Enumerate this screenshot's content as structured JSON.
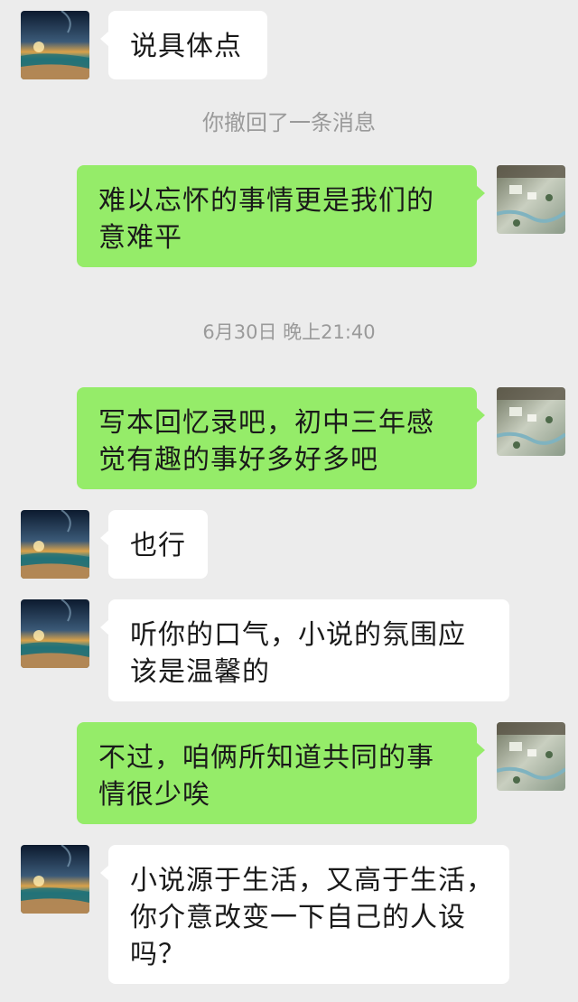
{
  "messages": [
    {
      "kind": "text",
      "side": "left",
      "lines": [
        "说具体点"
      ]
    },
    {
      "kind": "system",
      "text": "你撤回了一条消息"
    },
    {
      "kind": "text",
      "side": "right",
      "lines": [
        "难以忘怀的事情更是我们的",
        "意难平"
      ]
    },
    {
      "kind": "timestamp",
      "text": "6月30日 晚上21:40"
    },
    {
      "kind": "text",
      "side": "right",
      "lines": [
        "写本回忆录吧，初中三年感",
        "觉有趣的事好多好多吧"
      ]
    },
    {
      "kind": "text",
      "side": "left",
      "lines": [
        "也行"
      ]
    },
    {
      "kind": "text",
      "side": "left",
      "lines": [
        "听你的口气，小说的氛围应",
        "该是温馨的"
      ]
    },
    {
      "kind": "text",
      "side": "right",
      "lines": [
        "不过，咱俩所知道共同的事",
        "情很少唉"
      ]
    },
    {
      "kind": "text",
      "side": "left",
      "lines": [
        "小说源于生活，又高于生活，",
        "你介意改变一下自己的人设",
        "吗？"
      ]
    }
  ],
  "colors": {
    "background": "#ececec",
    "outgoing_bubble": "#95ec69",
    "incoming_bubble": "#ffffff",
    "system_text": "#9a9a9a"
  },
  "icons": {
    "contact_avatar": "night-sky-beach-avatar",
    "self_avatar": "aerial-village-map-avatar"
  }
}
